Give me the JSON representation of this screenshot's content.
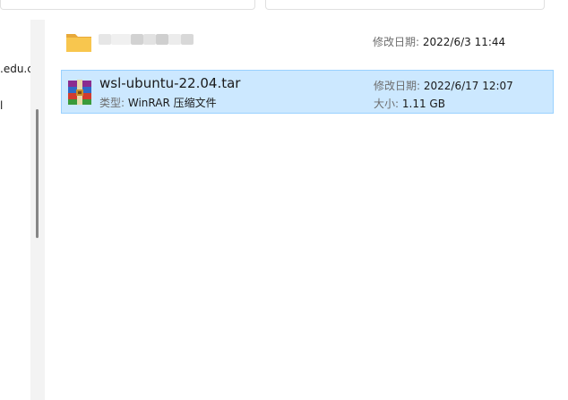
{
  "navigation": {
    "items": [
      {
        "label": ".edu.c"
      },
      {
        "label": "l"
      }
    ]
  },
  "files": [
    {
      "name": "",
      "name_blurred": true,
      "type_icon": "folder-icon",
      "modified_label": "修改日期:",
      "modified_value": "2022/6/3 11:44",
      "selected": false
    },
    {
      "name": "wsl-ubuntu-22.04.tar",
      "type_icon": "winrar-archive-icon",
      "type_label": "类型:",
      "type_value": "WinRAR 压缩文件",
      "modified_label": "修改日期:",
      "modified_value": "2022/6/17 12:07",
      "size_label": "大小:",
      "size_value": "1.11 GB",
      "selected": true
    }
  ],
  "colors": {
    "selection_bg": "#cce8ff",
    "selection_border": "#99d1ff",
    "folder": "#f8c64e"
  }
}
